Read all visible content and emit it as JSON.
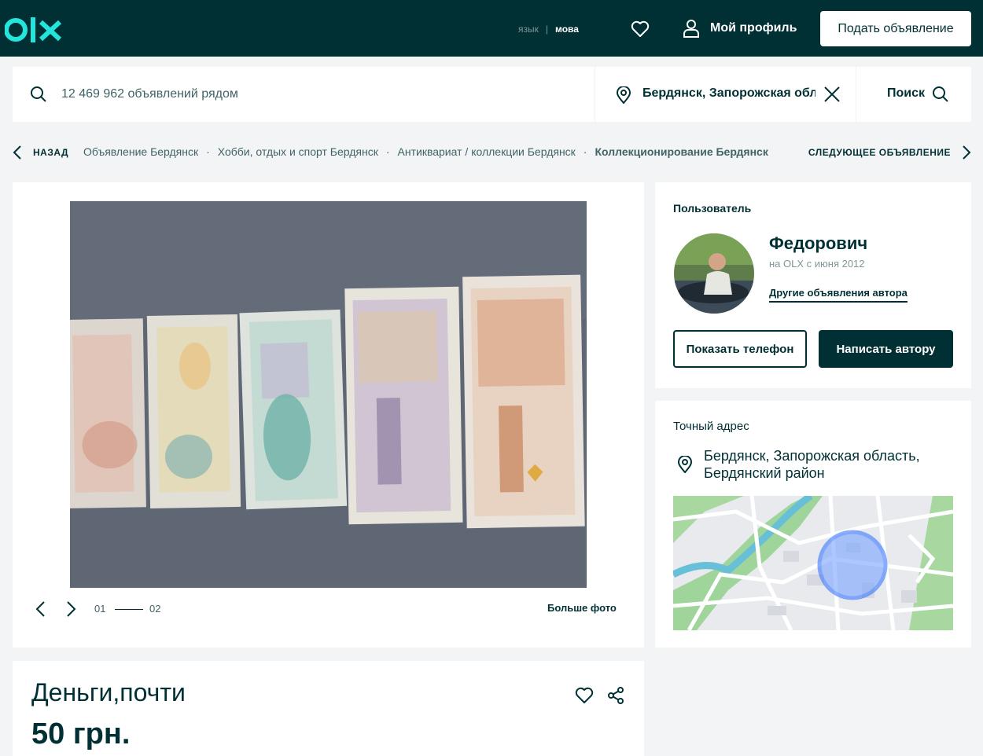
{
  "header": {
    "lang_ru": "язык",
    "lang_separator": "|",
    "lang_ua": "мова",
    "profile_label": "Мой профиль",
    "post_ad_label": "Подать объявление"
  },
  "search": {
    "query_placeholder": "12 469 962 объявлений рядом",
    "location_value": "Бердянск, Запорожская область",
    "search_button": "Поиск"
  },
  "breadcrumbs": {
    "back_label": "НАЗАД",
    "items": [
      "Объявление Бердянск",
      "Хобби, отдых и спорт Бердянск",
      "Антиквариат / коллекции Бердянск",
      "Коллекционирование Бердянск"
    ],
    "separator": "·",
    "next_label": "СЛЕДУЮЩЕЕ ОБЪЯВЛЕНИЕ"
  },
  "gallery": {
    "current": "01",
    "total": "02",
    "bigger_photos": "Больше фото"
  },
  "listing": {
    "title": "Деньги,почти",
    "price": "50 грн."
  },
  "user": {
    "section_label": "Пользователь",
    "name": "Федорович",
    "member_since": "на OLX с июня 2012",
    "other_ads": "Другие объявления автора",
    "show_phone": "Показать телефон",
    "write_author": "Написать автору"
  },
  "address": {
    "section_label": "Точный адрес",
    "text": "Бердянск, Запорожская область, Бердянский район"
  },
  "colors": {
    "brand_dark": "#002f34",
    "brand_accent": "#23e5db",
    "background": "#f2f4f5",
    "map_circle": "#3a77ff"
  },
  "icons": {
    "logo": "olx-logo",
    "favorite": "heart-icon",
    "profile": "user-icon",
    "search": "search-icon",
    "location": "location-pin-icon",
    "clear": "close-icon",
    "back": "chevron-left-icon",
    "next": "chevron-right-icon",
    "share": "share-icon"
  }
}
